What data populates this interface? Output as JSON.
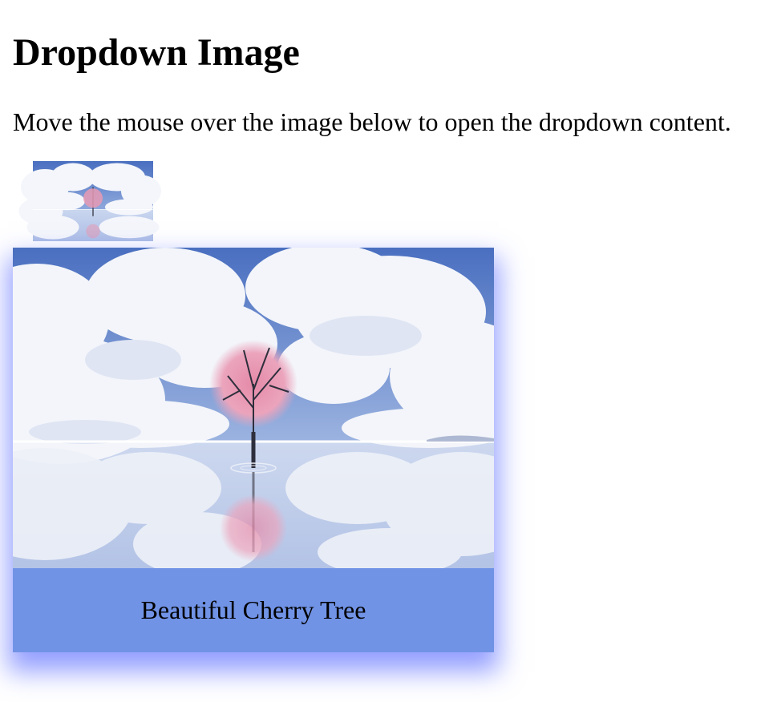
{
  "page": {
    "title": "Dropdown Image",
    "instructions": "Move the mouse over the image below to open the dropdown content."
  },
  "dropdown": {
    "thumbnail_alt": "Cherry Tree",
    "caption": "Beautiful Cherry Tree",
    "accent_color": "#7193e6",
    "shadow_color": "#4f5dff"
  }
}
